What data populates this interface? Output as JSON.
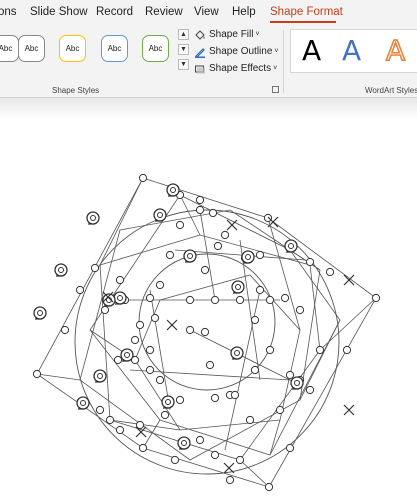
{
  "tabs": [
    {
      "label": "ons"
    },
    {
      "label": "Slide Show"
    },
    {
      "label": "Record"
    },
    {
      "label": "Review"
    },
    {
      "label": "View"
    },
    {
      "label": "Help"
    },
    {
      "label": "Shape Format"
    }
  ],
  "shape_styles": {
    "presets": [
      {
        "label": "Abc",
        "border": "#888888"
      },
      {
        "label": "Abc",
        "border": "#888888"
      },
      {
        "label": "Abc",
        "border": "#ffc000"
      },
      {
        "label": "Abc",
        "border": "#5b9bd5"
      },
      {
        "label": "Abc",
        "border": "#70ad47"
      }
    ],
    "fill_label": "Shape Fill",
    "outline_label": "Shape Outline",
    "effects_label": "Shape Effects",
    "group_label": "Shape Styles"
  },
  "wordart": {
    "letters": [
      "A",
      "A",
      "A"
    ],
    "group_label": "WordArt Styles"
  },
  "colors": {
    "accent": "#c43e1c",
    "text_blue": "#4472c4",
    "text_orange": "#ed7d31"
  }
}
